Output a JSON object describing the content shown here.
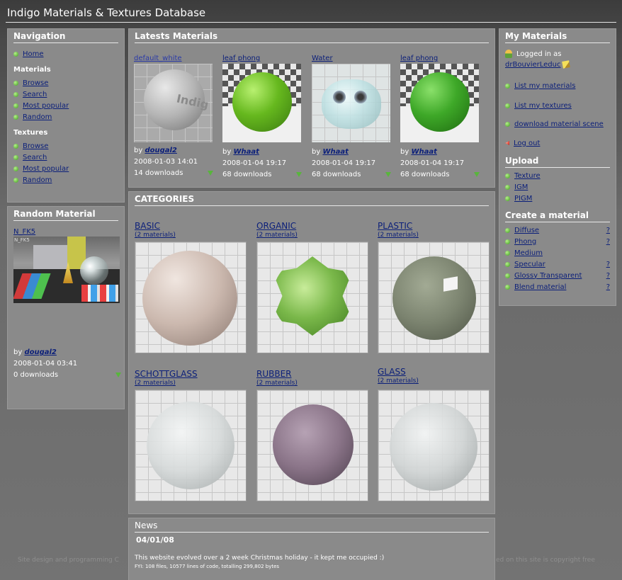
{
  "header": {
    "title": "Indigo Materials & Textures Database"
  },
  "navigation": {
    "title": "Navigation",
    "home": "Home",
    "materials_heading": "Materials",
    "materials_links": [
      "Browse",
      "Search",
      "Most popular",
      "Random"
    ],
    "textures_heading": "Textures",
    "textures_links": [
      "Browse",
      "Search",
      "Most popular",
      "Random"
    ]
  },
  "random_material": {
    "title": "Random Material",
    "name": "N_FK5",
    "thumb_caption": "N_FK5",
    "by_prefix": "by",
    "author": "dougal2",
    "date": "2008-01-04 03:41",
    "downloads": "0 downloads"
  },
  "latest": {
    "title": "Latests Materials",
    "items": [
      {
        "name": "default_white",
        "by_prefix": "by",
        "author": "dougal2",
        "date": "2008-01-03 14:01",
        "downloads": "14 downloads",
        "thumb_text": "Indig"
      },
      {
        "name": "leaf phong",
        "by_prefix": "by",
        "author": "Whaat",
        "date": "2008-01-04 19:17",
        "downloads": "68 downloads"
      },
      {
        "name": "Water",
        "by_prefix": "by",
        "author": "Whaat",
        "date": "2008-01-04 19:17",
        "downloads": "68 downloads"
      },
      {
        "name": "leaf phong",
        "by_prefix": "by",
        "author": "Whaat",
        "date": "2008-01-04 19:17",
        "downloads": "68 downloads"
      }
    ]
  },
  "categories": {
    "title": "CATEGORIES",
    "items": [
      {
        "name": "BASIC",
        "count": "(2 materials)",
        "color": "#d8c8c0"
      },
      {
        "name": "ORGANIC",
        "count": "(2 materials)",
        "color": "#6fae3c"
      },
      {
        "name": "PLASTIC",
        "count": "(2 materials)",
        "color": "#7e8670"
      },
      {
        "name": "SCHOTTGLASS",
        "count": "(2 materials)",
        "color": "#d4d8d8"
      },
      {
        "name": "RUBBER",
        "count": "(2 materials)",
        "color": "#8a7488"
      },
      {
        "name": "GLASS",
        "count": "(2 materials)",
        "color": "#d0d4d4"
      }
    ]
  },
  "news": {
    "title": "News",
    "date": "04/01/08",
    "line1": "This website evolved over a 2 week Christmas holiday - it kept me occupied :)",
    "line2": "FYI: 108 files, 10577 lines of code, totalling 299,802 bytes"
  },
  "footer": {
    "left": "Site design and programming C",
    "right": "ed on this site is copyright free"
  },
  "my_materials": {
    "title": "My Materials",
    "logged_in_as": "Logged in as",
    "username": "drBouvierLeduc",
    "links": [
      "List my materials",
      "List my textures",
      "download material scene"
    ],
    "logout": "Log out"
  },
  "upload": {
    "title": "Upload",
    "links": [
      "Texture",
      "IGM",
      "PIGM"
    ]
  },
  "create": {
    "title": "Create a material",
    "links": [
      "Diffuse",
      "Phong",
      "Medium",
      "Specular",
      "Glossy Transparent",
      "Blend material"
    ],
    "help_mark": "?"
  },
  "colors": {
    "panel": "#8a8a8a",
    "link": "#0b1f7a",
    "bullet_green": "#3c9a1e",
    "logout_red": "#c0160c"
  },
  "icons": [
    "bullet-icon",
    "user-icon",
    "pencil-icon",
    "download-arrow-icon",
    "logout-arrow-icon"
  ]
}
